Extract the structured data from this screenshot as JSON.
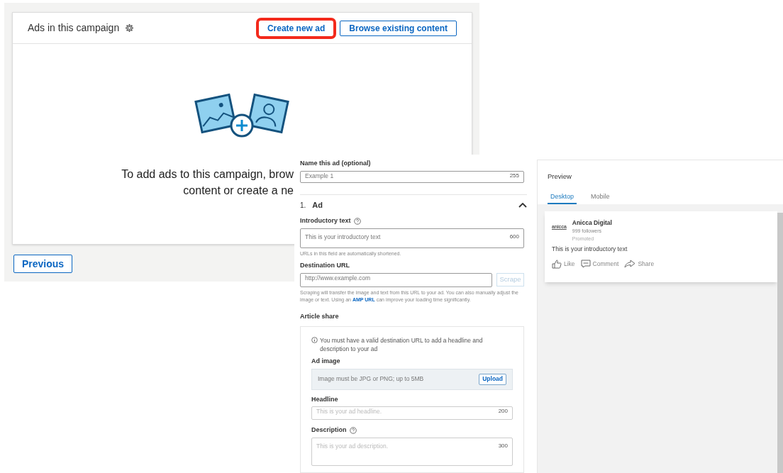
{
  "campaign_panel": {
    "title": "Ads in this campaign",
    "buttons": [
      {
        "label": "Create new ad",
        "highlighted": true
      },
      {
        "label": "Browse existing content",
        "highlighted": false
      }
    ],
    "message_lines": [
      "To add ads to this campaign, brow",
      "content or create a ne"
    ],
    "previous_button": "Previous"
  },
  "ad_form": {
    "name_field": {
      "label": "Name this ad (optional)",
      "placeholder": "Example 1",
      "counter": "255"
    },
    "section": {
      "number": "1.",
      "title": "Ad",
      "expanded": true
    },
    "intro_field": {
      "label": "Introductory text",
      "placeholder": "This is your introductory text",
      "counter": "600",
      "hint": "URLs in this field are automatically shortened."
    },
    "destination_field": {
      "label": "Destination URL",
      "placeholder": "http://www.example.com",
      "button": "Scrape",
      "hint_start": "Scraping will transfer the image and text from this URL to your ad. You can also manually adjust the image or text. Using an",
      "hint_link": "AMP URL",
      "hint_end": "can improve your loading time significantly."
    },
    "article_share": {
      "title": "Article share",
      "notice": "You must have a valid destination URL to add a headline and description to your ad",
      "image": {
        "label": "Ad image",
        "placeholder": "Image must be JPG or PNG; up to 5MB",
        "button": "Upload"
      },
      "headline": {
        "label": "Headline",
        "placeholder": "This is your ad headline.",
        "counter": "200"
      },
      "description": {
        "label": "Description",
        "placeholder": "This is your ad description.",
        "counter": "300"
      }
    }
  },
  "preview": {
    "title": "Preview",
    "tabs": [
      {
        "label": "Desktop",
        "selected": true
      },
      {
        "label": "Mobile",
        "selected": false
      }
    ],
    "post": {
      "logo_text": "anicca",
      "company": "Anicca Digital",
      "followers": "999 followers",
      "promoted": "Promoted",
      "text": "This is your introductory text",
      "actions": [
        {
          "label": "Like",
          "kind": "like"
        },
        {
          "label": "Comment",
          "kind": "comment"
        },
        {
          "label": "Share",
          "kind": "share"
        }
      ]
    }
  }
}
